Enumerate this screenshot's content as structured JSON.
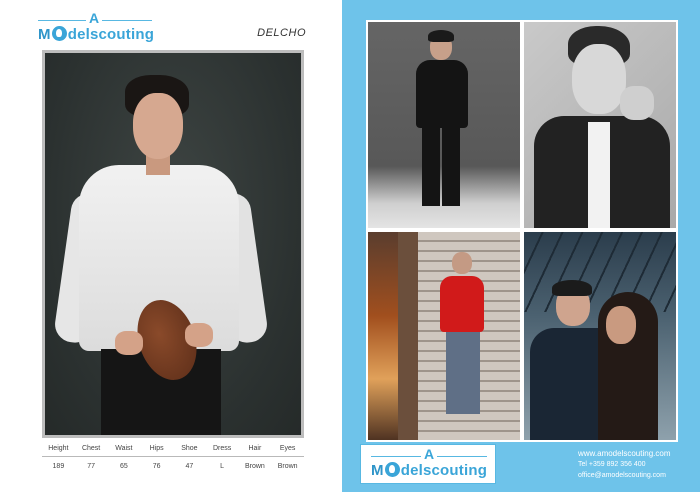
{
  "brand": {
    "letter_a": "A",
    "word_prefix": "M",
    "word_rest": "delscouting"
  },
  "model": {
    "name": "DELCHO"
  },
  "stats": {
    "headers": [
      "Height",
      "Chest",
      "Waist",
      "Hips",
      "Shoe",
      "Dress",
      "Hair",
      "Eyes"
    ],
    "values": [
      "189",
      "77",
      "65",
      "76",
      "47",
      "L",
      "Brown",
      "Brown"
    ]
  },
  "contact": {
    "website": "www.amodelscouting.com",
    "phone": "Tel +359 892 356 400",
    "email": "office@amodelscouting.com"
  },
  "colors": {
    "right_page_bg": "#6ec3ea",
    "brand_blue": "#3aa5d8"
  }
}
